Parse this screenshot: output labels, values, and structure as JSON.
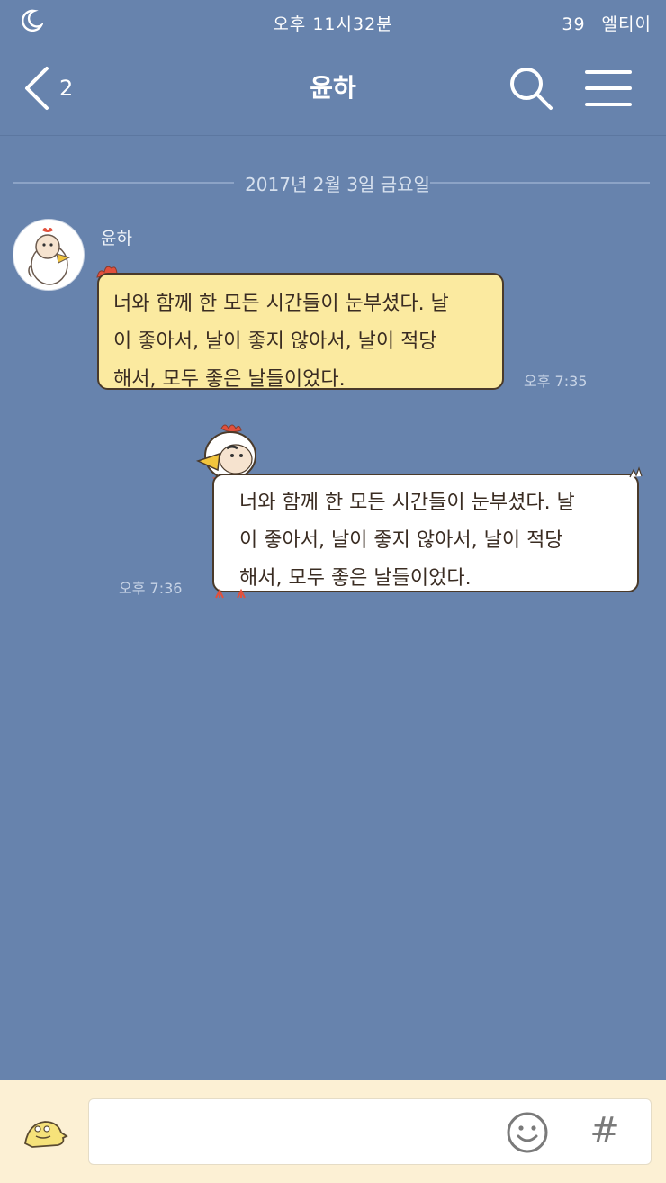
{
  "status_bar": {
    "time": "오후 11시32분",
    "battery": "39",
    "carrier": "엘티이"
  },
  "header": {
    "back_count": "2",
    "title": "윤하",
    "search_icon": "search-icon",
    "menu_icon": "menu-icon"
  },
  "chat": {
    "date_divider": "2017년 2월 3일 금요일",
    "messages": [
      {
        "direction": "incoming",
        "sender": "윤하",
        "lines": [
          "너와 함께 한 모든 시간들이 눈부셨다. 날",
          "이 좋아서, 날이 좋지 않아서, 날이 적당",
          "해서, 모두 좋은 날들이었다."
        ],
        "time": "오후 7:35"
      },
      {
        "direction": "outgoing",
        "lines": [
          "너와 함께 한 모든 시간들이 눈부셨다. 날",
          "이 좋아서, 날이 좋지 않아서, 날이 적당",
          "해서, 모두 좋은 날들이었다."
        ],
        "time": "오후 7:36"
      }
    ]
  },
  "input_bar": {
    "placeholder": "",
    "emoticon_icon": "emoticon-icon",
    "smile_icon": "smile-icon",
    "hash_label": "#"
  },
  "colors": {
    "background": "#6783ad",
    "incoming_bubble": "#fbeaa0",
    "outgoing_bubble": "#ffffff",
    "input_bar": "#fcf0d4"
  }
}
